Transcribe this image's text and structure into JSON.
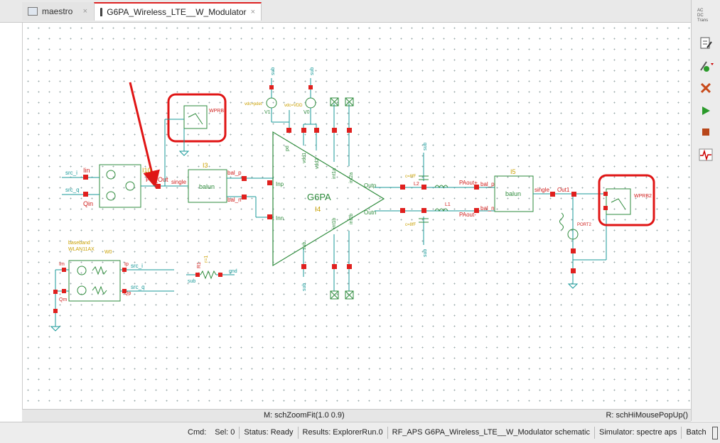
{
  "tabs": [
    {
      "label": "maestro",
      "active": false
    },
    {
      "label": "G6PA_Wireless_LTE__W_Modulator",
      "active": true
    }
  ],
  "tab_close_glyph": "×",
  "sim_radios": [
    "AC",
    "DC",
    "Trans"
  ],
  "toolbar_icons": [
    "edit-properties-icon",
    "probe-add-icon",
    "delete-cross-icon",
    "run-play-icon",
    "stop-icon",
    "waveform-icon"
  ],
  "schematic": {
    "main_block_name": "G6PA",
    "main_block_instance": "I4",
    "left_balun": {
      "label": "balun",
      "instance": "I3",
      "single": "single",
      "bal_p": "bal_p",
      "bal_n": "bal_n"
    },
    "right_balun": {
      "label": "balun",
      "instance": "I5",
      "single": "single",
      "bal_p": "bal_p",
      "bal_n": "bal_n"
    },
    "modulator": {
      "instance": "I10",
      "iin": "Iin",
      "qin": "Qin",
      "src_i": "src_i",
      "src_q": "src_q",
      "out": "PB_Out"
    },
    "pa_pins": {
      "inp": "Inp",
      "inn": "Inn",
      "outp": "Outp",
      "outn": "Outn",
      "pd": "pd",
      "vdd1": "vdd1",
      "vdd2": "vdd2",
      "int1a": "int1a",
      "int1b": "int1b",
      "int2a": "int2a",
      "int2b": "int2b",
      "sub": "sub"
    },
    "supplies": {
      "v1": "V1",
      "v0": "V0",
      "v1_val": "vdc=pdet",
      "v0_val": "vdc=VDD",
      "sub": "sub"
    },
    "baseband": {
      "title": "baseband",
      "model": "WLAN11AX",
      "instance": "W0",
      "im": "Im",
      "qm": "Qm",
      "ip": "Ip",
      "qp": "Qp",
      "src_i": "src_i",
      "src_q": "src_q"
    },
    "resistor": {
      "instance": "R1",
      "param": "r=1",
      "left": "sub",
      "right": "gnd"
    },
    "output": {
      "paout_p": "PAout+",
      "paout_n": "PAout-",
      "out1": "Out1",
      "port": "PORT2",
      "l2": "L2",
      "l1": "L1",
      "c_val": "c=8fF"
    },
    "probes": [
      {
        "label": "WPRB"
      },
      {
        "label": "WPRB2"
      }
    ]
  },
  "hint_left": "M: schZoomFit(1.0 0.9)",
  "hint_right": "R: schHiMousePopUp()",
  "status": {
    "cmd": "Cmd:",
    "sel": "Sel: 0",
    "state": "Status: Ready",
    "results": "Results: ExplorerRun.0",
    "view": "RF_APS G6PA_Wireless_LTE__W_Modulator schematic",
    "simulator": "Simulator: spectre aps",
    "mode": "Batch"
  },
  "colors": {
    "wire": "#1a9a9a",
    "pin": "#e0201e",
    "block": "#2e8b3c",
    "label": "#d0201e",
    "highlight": "#e01515",
    "inst": "#c9a000"
  }
}
